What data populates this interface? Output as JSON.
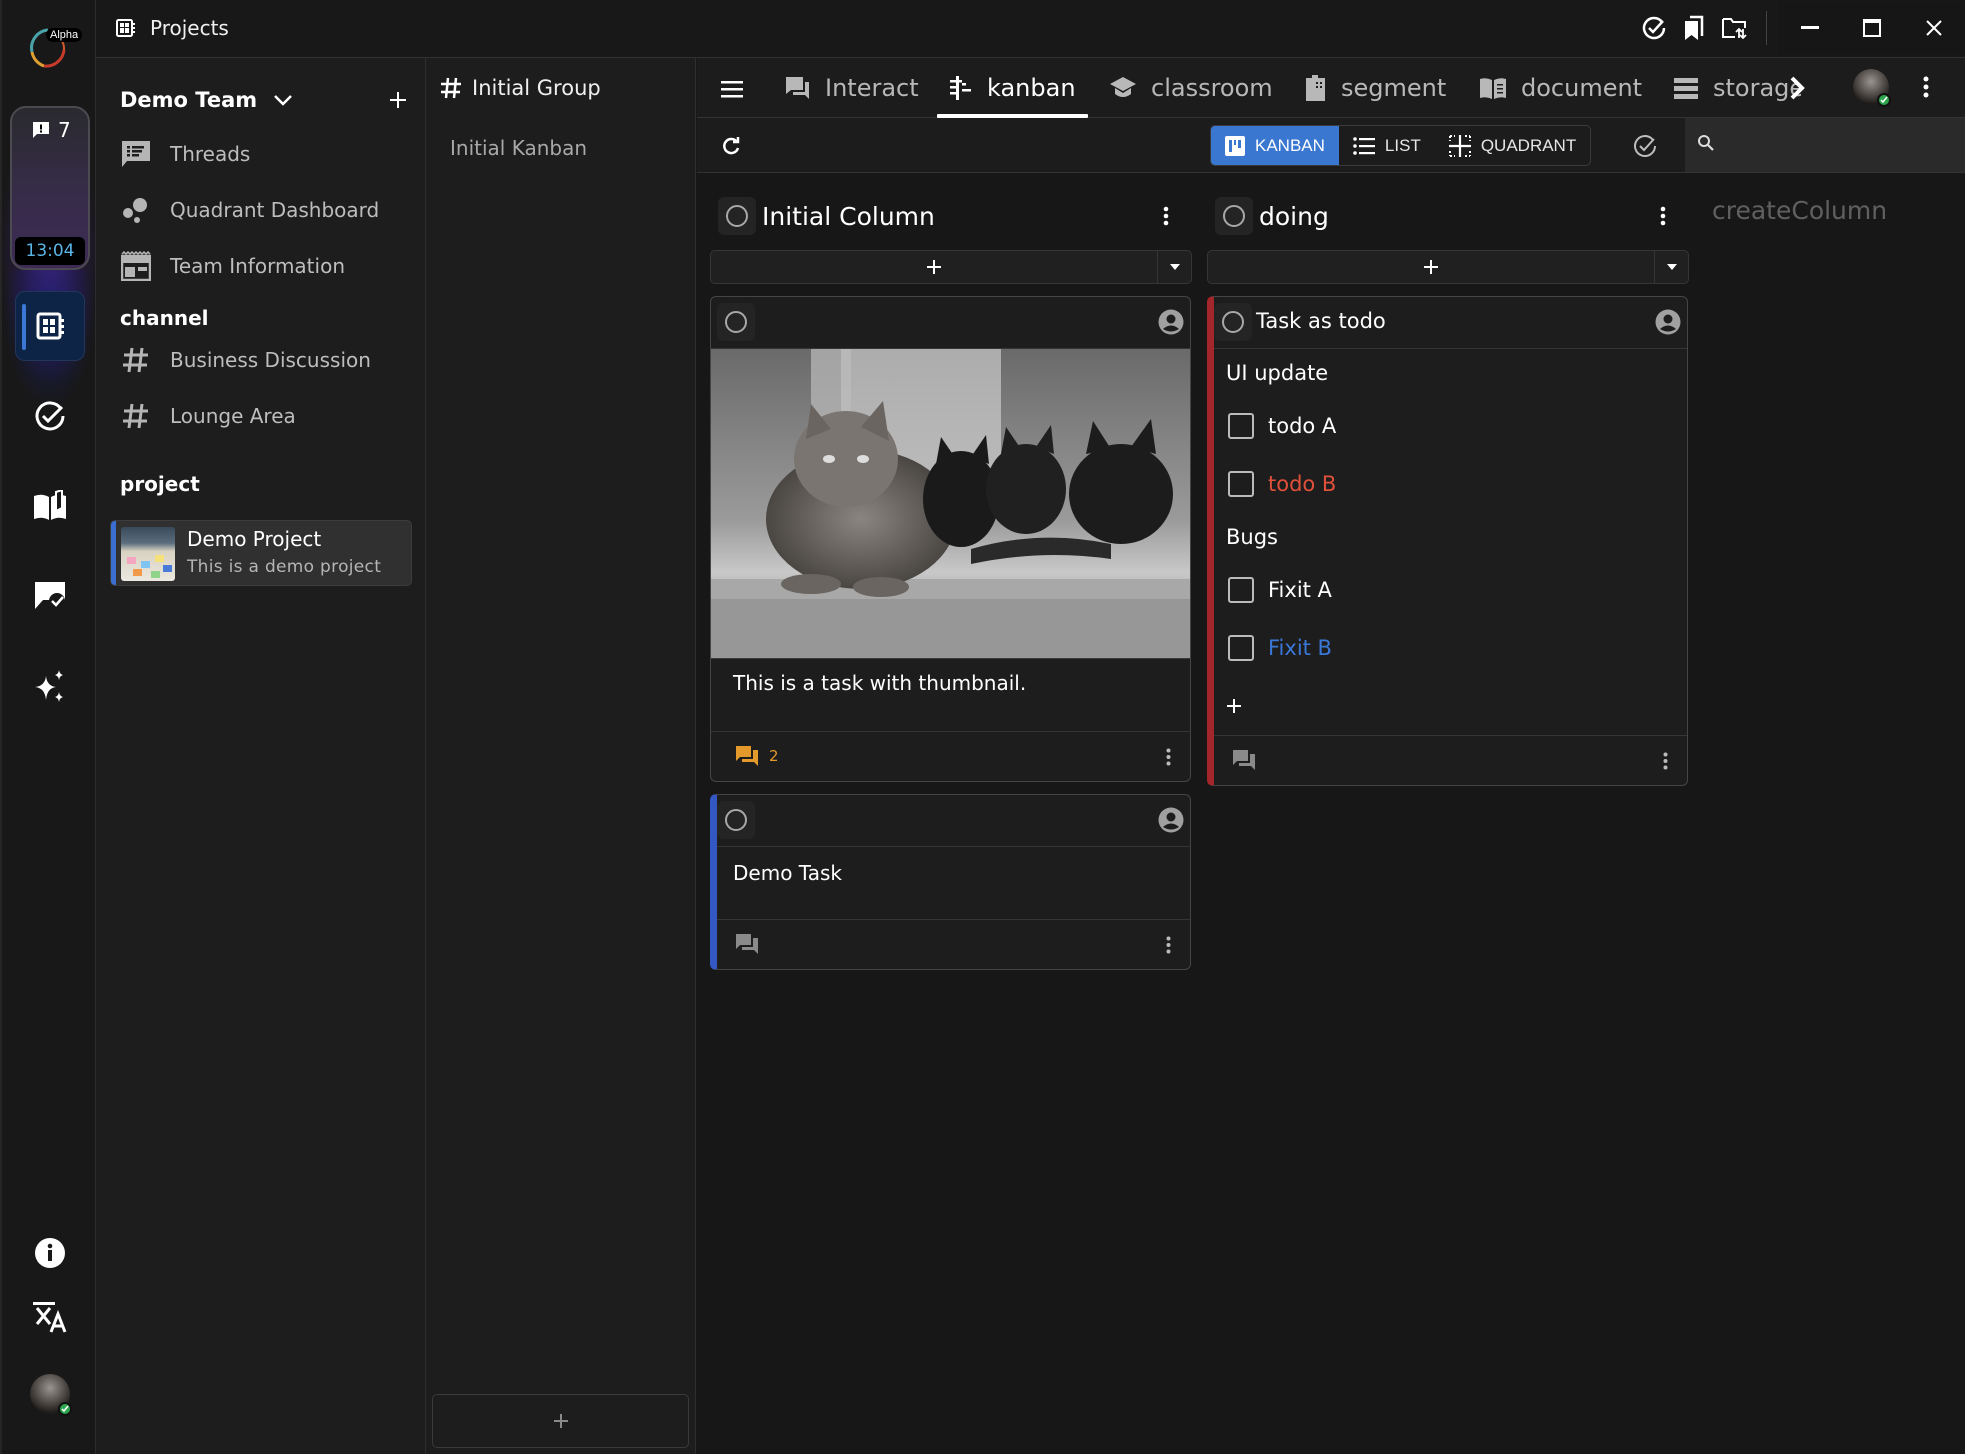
{
  "app": {
    "title": "Projects",
    "logo_badge": "Alpha",
    "notification_count": "7",
    "clock": "13:04"
  },
  "rail": {
    "items": [
      {
        "name": "projects",
        "icon": "projects-icon",
        "active": true
      },
      {
        "name": "tasks",
        "icon": "check-circle-icon",
        "active": false
      },
      {
        "name": "documents",
        "icon": "book-open-icon",
        "active": false
      },
      {
        "name": "approvals",
        "icon": "chat-check-icon",
        "active": false
      },
      {
        "name": "ai",
        "icon": "sparkles-icon",
        "active": false
      }
    ],
    "bottom": [
      {
        "name": "info",
        "icon": "info-icon"
      },
      {
        "name": "translate",
        "icon": "translate-icon"
      },
      {
        "name": "profile",
        "icon": "user-avatar"
      }
    ]
  },
  "titlebar": {
    "icons": [
      "check-circle-icon",
      "bookmarks-icon",
      "folder-sync-icon"
    ],
    "window_controls": [
      "minimize",
      "maximize",
      "close"
    ]
  },
  "team": {
    "name": "Demo Team",
    "items": [
      {
        "label": "Threads",
        "icon": "threads-icon"
      },
      {
        "label": "Quadrant Dashboard",
        "icon": "bubbles-icon"
      },
      {
        "label": "Team Information",
        "icon": "team-info-icon"
      }
    ],
    "channel_header": "channel",
    "channels": [
      {
        "label": "Business Discussion"
      },
      {
        "label": "Lounge Area"
      }
    ],
    "project_header": "project",
    "projects": [
      {
        "title": "Demo Project",
        "description": "This is a demo project",
        "selected": true
      }
    ]
  },
  "group": {
    "title": "Initial Group",
    "items": [
      {
        "label": "Initial Kanban"
      }
    ]
  },
  "tabs": [
    {
      "label": "Interact",
      "icon": "interact-icon",
      "active": false
    },
    {
      "label": "kanban",
      "icon": "kanban-icon",
      "active": true
    },
    {
      "label": "classroom",
      "icon": "classroom-icon",
      "active": false
    },
    {
      "label": "segment",
      "icon": "segment-icon",
      "active": false
    },
    {
      "label": "document",
      "icon": "document-icon",
      "active": false
    },
    {
      "label": "storage",
      "icon": "storage-icon",
      "active": false
    }
  ],
  "toolbar": {
    "views": [
      {
        "label": "KANBAN",
        "active": true
      },
      {
        "label": "LIST",
        "active": false
      },
      {
        "label": "QUADRANT",
        "active": false
      }
    ],
    "search_placeholder": "",
    "search_value": ""
  },
  "board": {
    "columns": [
      {
        "title": "Initial Column",
        "cards": [
          {
            "title": "",
            "has_thumbnail": true,
            "text": "This is a task with thumbnail.",
            "comment_count": "2",
            "accent": null
          },
          {
            "title": "",
            "has_thumbnail": false,
            "text": "Demo Task",
            "comment_count": "",
            "accent": "#3358c4"
          }
        ]
      },
      {
        "title": "doing",
        "cards": [
          {
            "title": "Task as todo",
            "accent": "#a3262b",
            "todo_groups": [
              {
                "label": "UI update",
                "items": [
                  {
                    "label": "todo A",
                    "color": "#ffffff",
                    "checked": false
                  },
                  {
                    "label": "todo B",
                    "color": "#e0503a",
                    "checked": false
                  }
                ]
              },
              {
                "label": "Bugs",
                "items": [
                  {
                    "label": "Fixit A",
                    "color": "#ffffff",
                    "checked": false
                  },
                  {
                    "label": "Fixit B",
                    "color": "#3a78d8",
                    "checked": false
                  }
                ]
              }
            ],
            "comment_count": ""
          }
        ]
      }
    ],
    "create_column_label": "createColumn"
  }
}
